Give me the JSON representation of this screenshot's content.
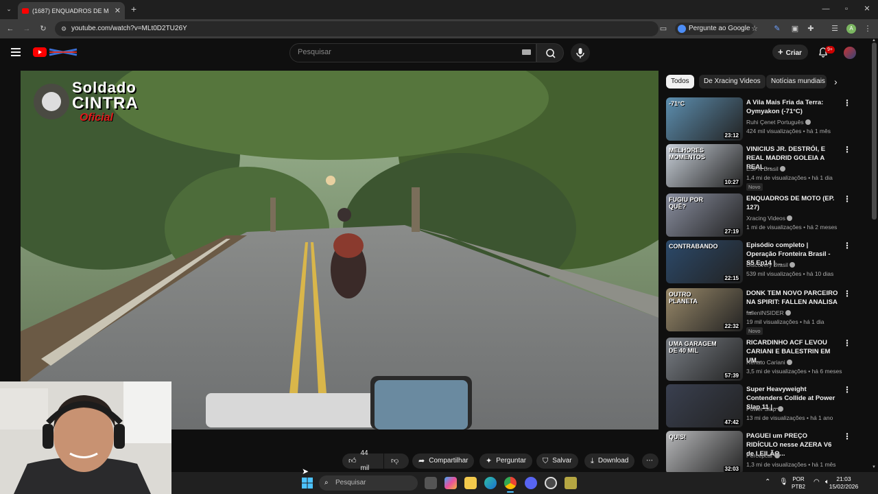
{
  "browser": {
    "tab_title": "(1687) ENQUADROS DE M",
    "url": "youtube.com/watch?v=MLt0D2TU26Y",
    "ask_google": "Pergunte ao Google"
  },
  "youtube": {
    "search_placeholder": "Pesquisar",
    "create_label": "Criar",
    "notifications_badge": "9+"
  },
  "video": {
    "watermark_line1": "Soldado",
    "watermark_line2": "CINTRA",
    "watermark_line3": "Oficial"
  },
  "actions": {
    "like_count": "44 mil",
    "share": "Compartilhar",
    "ask": "Perguntar",
    "save": "Salvar",
    "download": "Download"
  },
  "chips": [
    "Todos",
    "De Xracing Videos",
    "Notícias mundiais"
  ],
  "recommendations": [
    {
      "title": "A Vila Mais Fria da Terra: Oymyakon (-71°C)",
      "channel": "Ruhi Çenet Português",
      "meta": "424 mil visualizações • há 1 mês",
      "duration": "23:12",
      "badge": "",
      "thumb_text": "-71°C",
      "thumb_color": "#5d8fb0"
    },
    {
      "title": "VINICIUS JR. DESTRÓI, E REAL MADRID GOLEIA A REAL ...",
      "channel": "ESPN Brasil",
      "meta": "1,4 mi de visualizações • há 1 dia",
      "duration": "10:27",
      "badge": "Novo",
      "thumb_text": "MELHORES MOMENTOS",
      "thumb_color": "#c8cfd8"
    },
    {
      "title": "ENQUADROS DE MOTO (EP. 127)",
      "channel": "Xracing Videos",
      "meta": "1 mi de visualizações • há 2 meses",
      "duration": "27:19",
      "badge": "",
      "thumb_text": "FUGIU POR QUÊ?",
      "thumb_color": "#8a8fa0"
    },
    {
      "title": "Episódio completo | Operação Fronteira Brasil - S5 Ep14 | ...",
      "channel": "Discovery Brasil",
      "meta": "539 mil visualizações • há 10 dias",
      "duration": "22:15",
      "badge": "",
      "thumb_text": "CONTRABANDO",
      "thumb_color": "#2c4a6b"
    },
    {
      "title": "DONK TEM NOVO PARCEIRO NA SPIRIT: FALLEN ANALISA ...",
      "channel": "fallenINSIDER",
      "meta": "19 mil visualizações • há 1 dia",
      "duration": "22:32",
      "badge": "Novo",
      "thumb_text": "OUTRO PLANETA",
      "thumb_color": "#9a8a6a"
    },
    {
      "title": "RICARDINHO ACF LEVOU CARIANI E BALESTRIN EM UM...",
      "channel": "Renato Cariani",
      "meta": "3,5 mi de visualizações • há 6 meses",
      "duration": "57:39",
      "badge": "",
      "thumb_text": "UMA GARAGEM DE 40 MIL",
      "thumb_color": "#7a7f86"
    },
    {
      "title": "Super Heavyweight Contenders Collide at Power Slap 11 | ...",
      "channel": "Power Slap",
      "meta": "13 mi de visualizações • há 1 ano",
      "duration": "47:42",
      "badge": "",
      "thumb_text": "",
      "thumb_color": "#3a4050"
    },
    {
      "title": "PAGUEI um PREÇO RIDÍCULO nesse AZERA V6 de LEILÃO...",
      "channel": "Percepcar",
      "meta": "1,3 mi de visualizações • há 1 mês",
      "duration": "32:03",
      "badge": "",
      "thumb_text": "QUIS!",
      "thumb_color": "#b8b9bb"
    }
  ],
  "taskbar": {
    "search_placeholder": "Pesquisar",
    "lang_line1": "POR",
    "lang_line2": "PTB2",
    "time": "21:03",
    "date": "15/02/2026"
  }
}
